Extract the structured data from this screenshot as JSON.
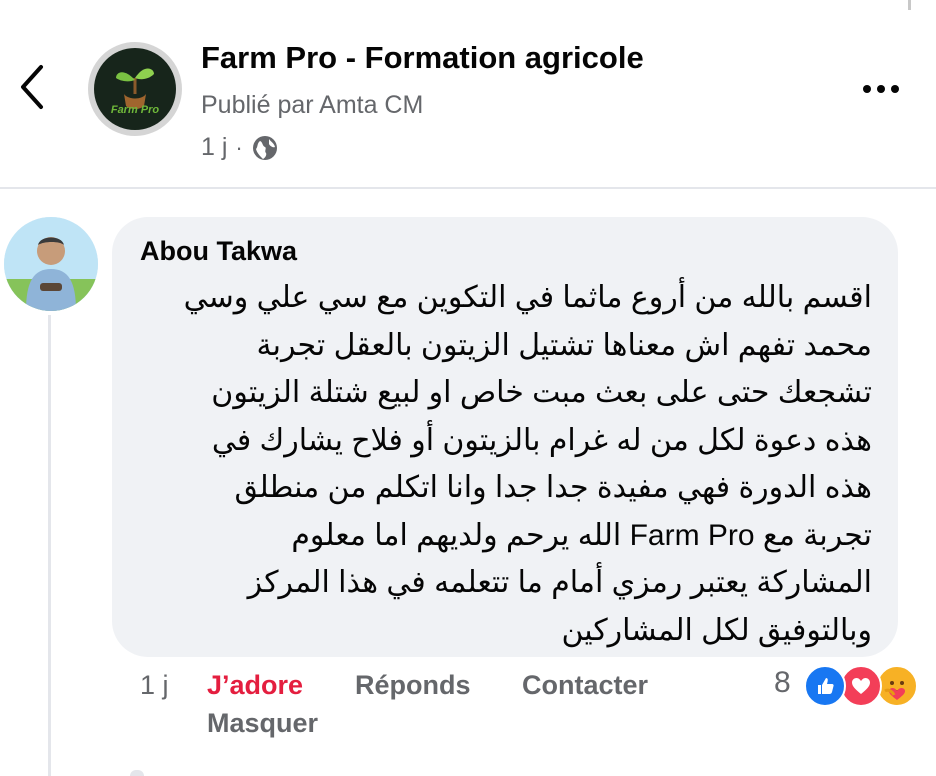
{
  "header": {
    "page_name": "Farm Pro - Formation agricole",
    "published_by": "Publié par Amta CM",
    "time": "1 j",
    "separator": "·",
    "privacy_icon": "globe-icon",
    "back_icon": "chevron-left-icon",
    "more_icon": "more-horizontal-icon",
    "avatar_brand": "Farm Pro",
    "brand_color": "#6fb83a"
  },
  "comment": {
    "author": "Abou Takwa",
    "lines": [
      "اقسم بالله من أروع ماثما في التكوين مع سي علي وسي",
      "محمد تفهم اش معناها تشتيل الزيتون بالعقل تجربة",
      "تشجعك حتى على بعث مبت خاص او لبيع شتلة الزيتون",
      "هذه دعوة لكل من له غرام بالزيتون أو فلاح يشارك في",
      "هذه الدورة فهي مفيدة جدا جدا وانا اتكلم من منطلق",
      "تجربة مع Farm Pro الله يرحم ولديهم اما معلوم",
      "المشاركة يعتبر رمزي أمام ما تتعلمه في هذا المركز",
      "وبالتوفيق لكل المشاركين"
    ],
    "bubble_color": "#f0f2f5"
  },
  "actions": {
    "time": "1 j",
    "love": "J’adore",
    "reply": "Réponds",
    "contact": "Contacter",
    "hide": "Masquer",
    "love_color": "#e41e3f",
    "reaction_count": "8",
    "reaction_icons": [
      "like-icon",
      "love-icon",
      "care-icon"
    ]
  }
}
